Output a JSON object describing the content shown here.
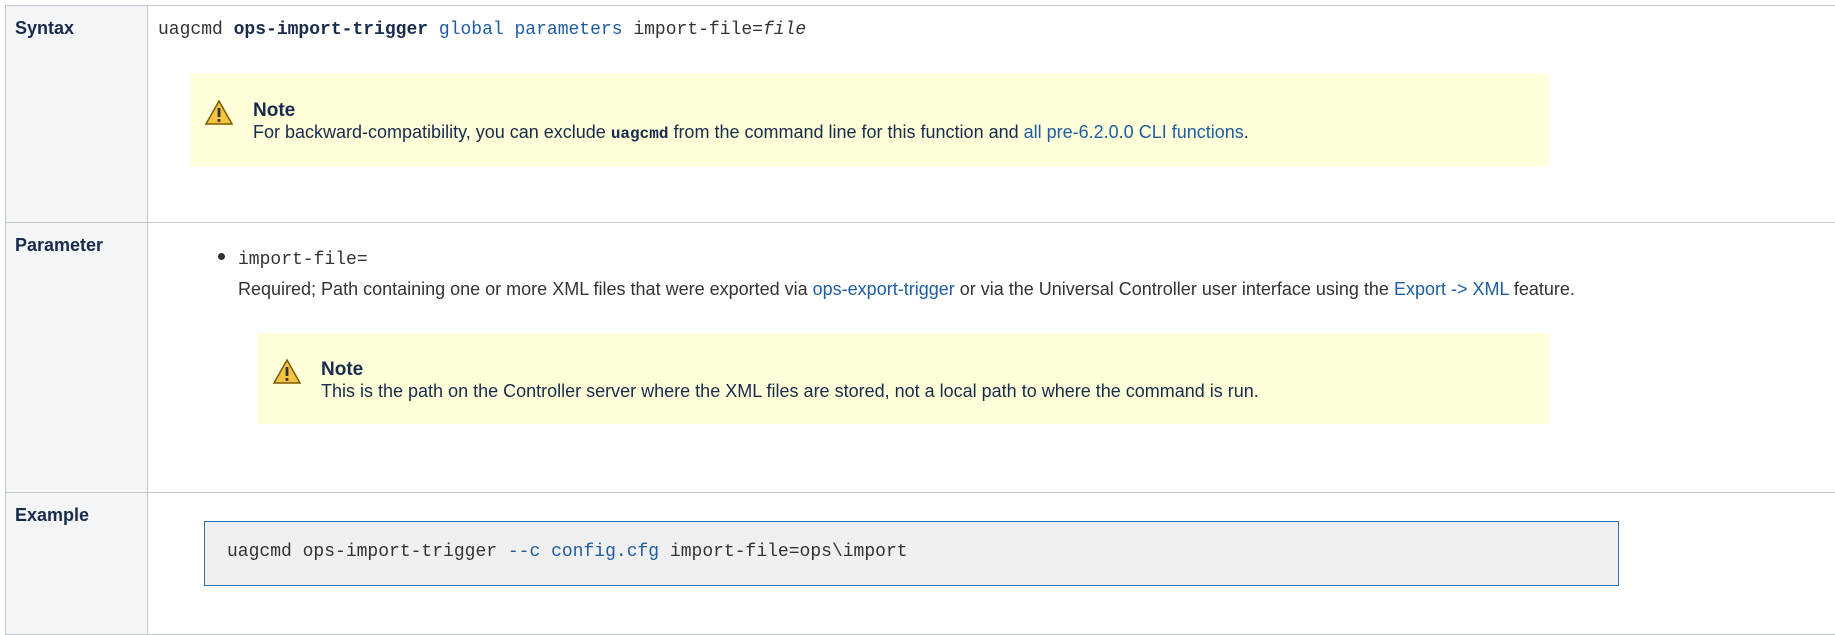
{
  "syntax": {
    "label": "Syntax",
    "cmd": "uagcmd ",
    "function": "ops-import-trigger",
    "sp1": " ",
    "link_global": "global",
    "sp2": " ",
    "link_parameters": "parameters",
    "rest": " import-file=",
    "arg": "file",
    "note": {
      "title": "Note",
      "text_before": "For backward-compatibility, you can exclude ",
      "code": "uagcmd",
      "text_middle": " from the command line for this function and ",
      "link": "all pre-6.2.0.0 CLI functions",
      "text_after": "."
    }
  },
  "parameter": {
    "label": "Parameter",
    "name": "import-file=",
    "desc_before": "Required; Path containing one or more XML files that were exported via ",
    "link_export_trigger": "ops-export-trigger",
    "desc_middle": " or via the Universal Controller user interface using the ",
    "link_export_xml": "Export -> XML",
    "desc_after": " feature.",
    "note": {
      "title": "Note",
      "text": "This is the path on the Controller server where the XML files are stored, not a local path to where the command is run."
    }
  },
  "example": {
    "label": "Example",
    "code_before": "uagcmd ops-import-trigger ",
    "code_opt": "--c",
    "code_sp": " ",
    "code_file": "config.cfg",
    "code_after": " import-file=ops\\import"
  },
  "colors": {
    "link": "#1f5da2",
    "note_bg": "#ffffd9",
    "label_bg": "#f4f5f7",
    "code_border": "#3572b0"
  }
}
